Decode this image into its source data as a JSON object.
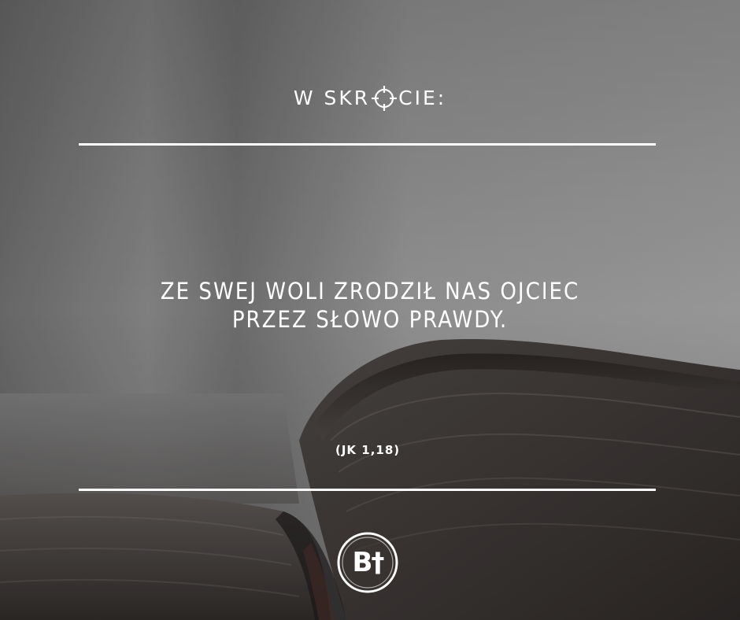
{
  "header": {
    "title_before": "W SKR",
    "title_after": "CIE:",
    "icon": "crosshair-icon"
  },
  "quote": {
    "line1": "ZE SWEJ WOLI ZRODZIŁ NAS OJCIEC",
    "line2": "PRZEZ SŁOWO PRAWDY."
  },
  "reference": "(JK 1,18)",
  "logo": {
    "text": "B†"
  },
  "colors": {
    "text": "#ffffff",
    "background_top": "#8c8c8c",
    "background_bottom": "#3d3936"
  }
}
